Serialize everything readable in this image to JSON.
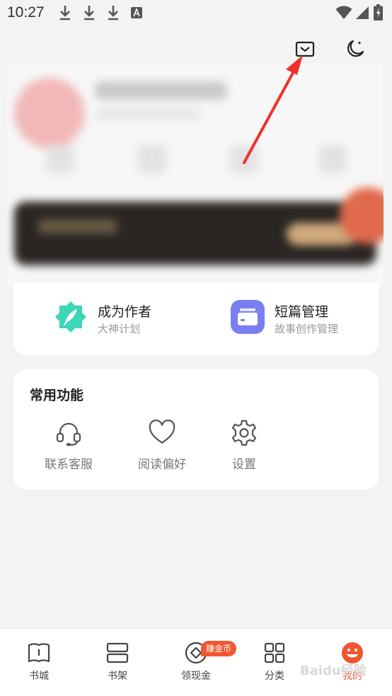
{
  "status_bar": {
    "time": "10:27"
  },
  "colors": {
    "accent": "#f0562f",
    "annotation_arrow": "#f0302a",
    "author_icon": "#3dd6b8",
    "short_icon": "#7b7ef0"
  },
  "header": {
    "icons": [
      "mail-icon",
      "moon-icon"
    ]
  },
  "features": [
    {
      "title": "成为作者",
      "subtitle": "大神计划",
      "icon": "feather-icon"
    },
    {
      "title": "短篇管理",
      "subtitle": "故事创作管理",
      "icon": "folder-icon"
    }
  ],
  "common_functions": {
    "title": "常用功能",
    "items": [
      {
        "label": "联系客服",
        "icon": "headset-icon"
      },
      {
        "label": "阅读偏好",
        "icon": "heart-icon"
      },
      {
        "label": "设置",
        "icon": "gear-icon"
      }
    ]
  },
  "tabs": [
    {
      "label": "书城",
      "icon": "book-icon"
    },
    {
      "label": "书架",
      "icon": "bookshelf-icon"
    },
    {
      "label": "领现金",
      "icon": "coin-icon",
      "badge": "赚金币"
    },
    {
      "label": "分类",
      "icon": "grid-icon"
    },
    {
      "label": "我的",
      "icon": "smiley-icon",
      "active": true
    }
  ],
  "watermark": "Baidu经验"
}
